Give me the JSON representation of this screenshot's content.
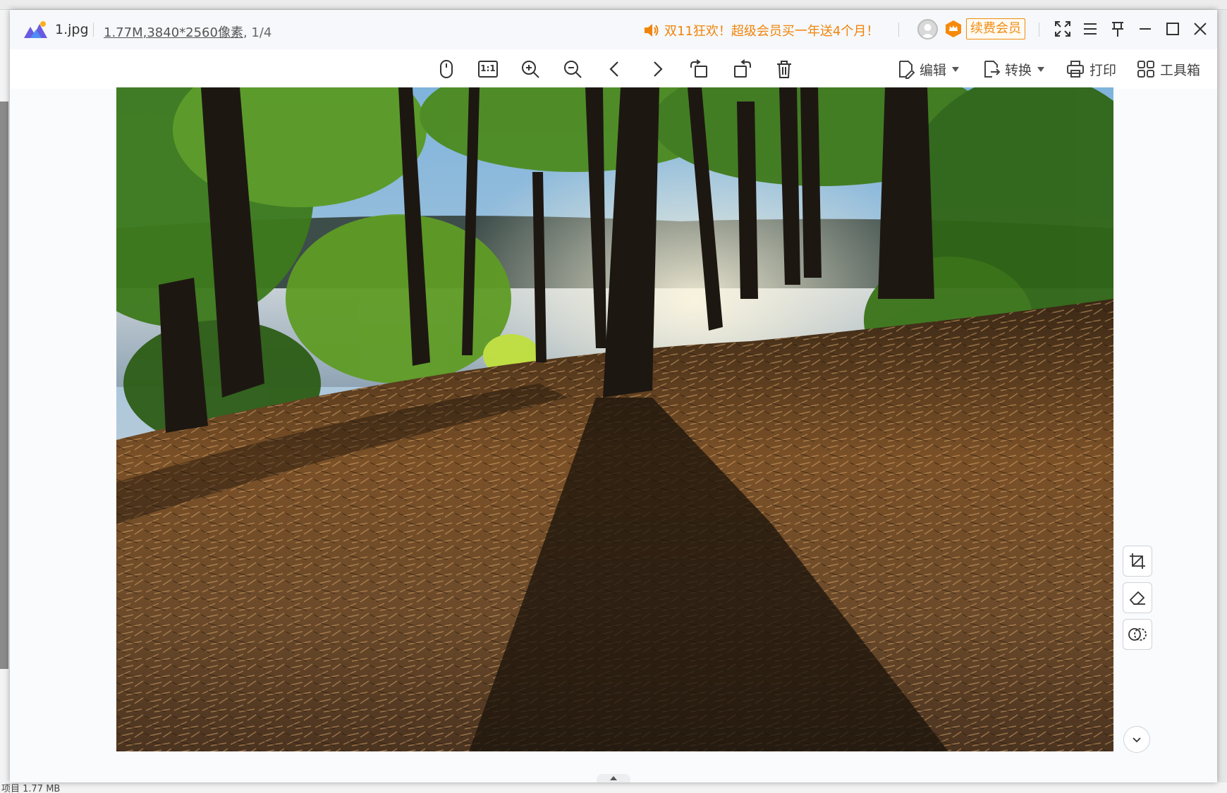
{
  "title_bar": {
    "filename": "1.jpg",
    "file_size": "1.77M",
    "dimensions": ",3840*2560像素",
    "page_index": ", 1/4",
    "promo_text": "双11狂欢！超级会员买一年送4个月！",
    "vip_button": "续费会员"
  },
  "toolbar": {
    "edit_label": "编辑",
    "convert_label": "转换",
    "print_label": "打印",
    "toolbox_label": "工具箱",
    "actual_size_label": "1:1"
  },
  "background": {
    "status_text": "项目 1.77 MB"
  },
  "colors": {
    "accent_orange": "#f08c10",
    "logo_purple": "#6a5ae0"
  },
  "icons": {
    "toolbar": [
      "mouse-icon",
      "actual-size-icon",
      "zoom-in-icon",
      "zoom-out-icon",
      "previous-icon",
      "next-icon",
      "rotate-left-icon",
      "rotate-right-icon",
      "delete-icon"
    ],
    "window": [
      "fullscreen-icon",
      "menu-icon",
      "pin-icon",
      "minimize-icon",
      "maximize-icon",
      "close-icon"
    ],
    "side": [
      "crop-icon",
      "eraser-icon",
      "compare-icon",
      "expand-down-icon"
    ]
  }
}
